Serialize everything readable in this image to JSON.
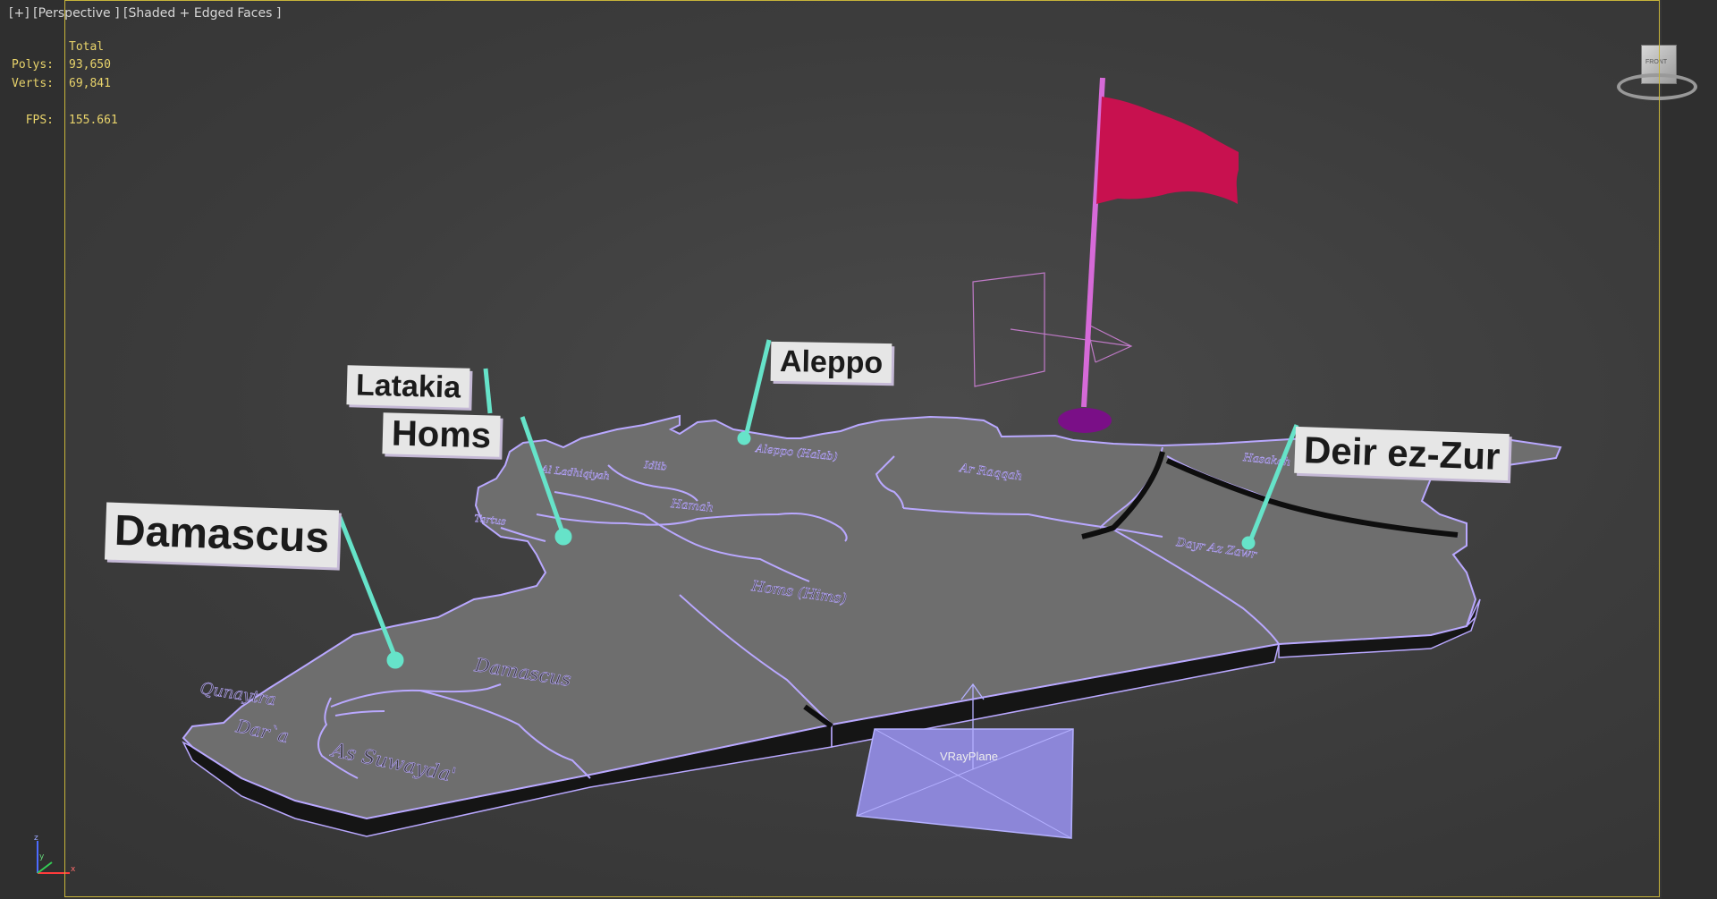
{
  "viewport": {
    "label_plus": "[+]",
    "label_view": "[Perspective ]",
    "label_shading": "[Shaded + Edged Faces ]"
  },
  "stats": {
    "header": "Total",
    "polys_label": "Polys:",
    "polys_value": "93,650",
    "verts_label": "Verts:",
    "verts_value": "69,841",
    "fps_label": "FPS:",
    "fps_value": "155.661"
  },
  "labels": {
    "damascus": "Damascus",
    "latakia": "Latakia",
    "homs": "Homs",
    "aleppo": "Aleppo",
    "deir": "Deir ez-Zur"
  },
  "map_regions": {
    "aleppo": "Aleppo (Halab)",
    "ar_raqqah": "Ar Raqqah",
    "hasakah": "Hasakah",
    "idlib": "Idlib",
    "latakia": "Al Ladhiqiyah",
    "hamah": "Hamah",
    "tartus": "Tartus",
    "homs": "Homs (Hims)",
    "deir": "Dayr Az Zawr",
    "damascus": "Damascus",
    "quneitra": "Qunaytra",
    "daraa": "Dar`a",
    "suwayda": "As Suwayda'"
  },
  "vrayplane_label": "VRayPlane",
  "viewcube_face": "FRONT",
  "axes": {
    "z": "z",
    "y": "y",
    "x": "x"
  },
  "colors": {
    "background": "#3a3a3a",
    "map_top": "#6e6e6e",
    "map_edge": "#b9a8ff",
    "pin": "#66e3c9",
    "flag": "#c8114f",
    "pole": "#d66ad8",
    "base": "#7a0f87",
    "vray": "#8c86d8"
  }
}
